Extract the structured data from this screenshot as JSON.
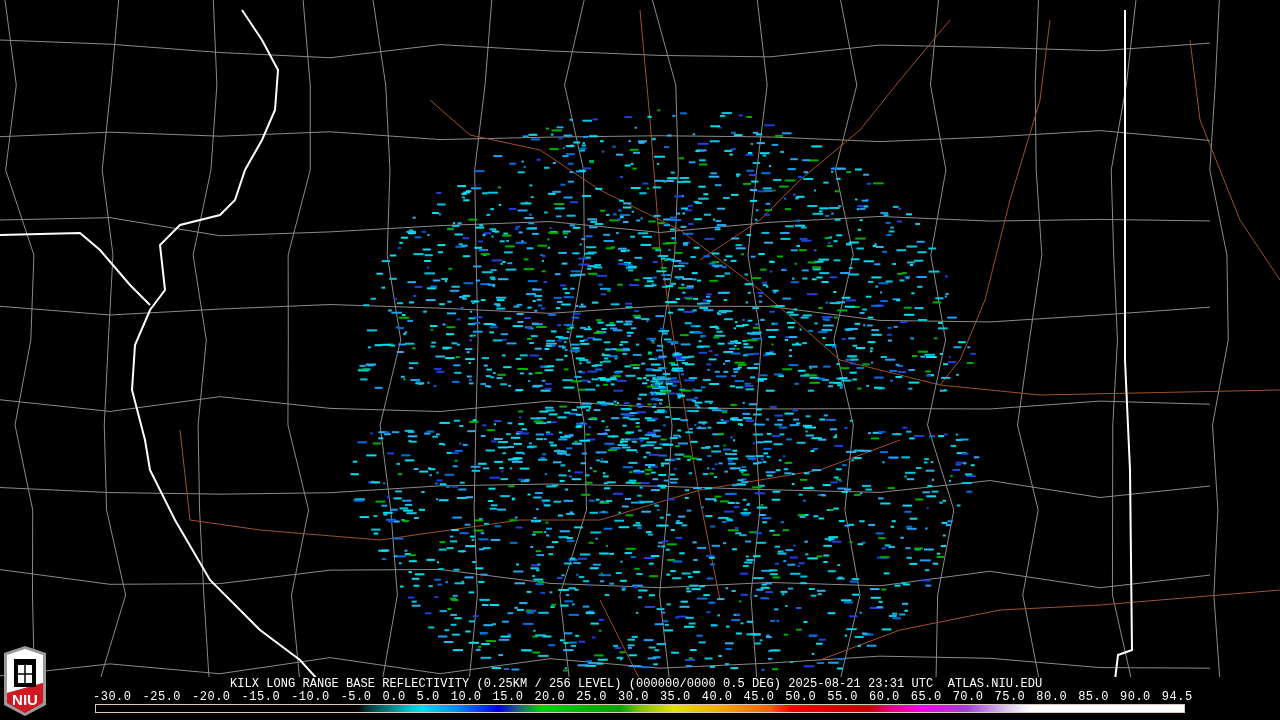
{
  "logo": {
    "text": "NIU"
  },
  "product_title": "KILX LONG RANGE BASE REFLECTIVITY (0.25KM / 256 LEVEL) (000000/0000 0.5 DEG) 2025-08-21 23:31 UTC  ATLAS.NIU.EDU",
  "scale": {
    "labels": [
      "-30.0",
      "-25.0",
      "-20.0",
      "-15.0",
      "-10.0",
      "-5.0",
      "0.0",
      "5.0",
      "10.0",
      "15.0",
      "20.0",
      "25.0",
      "30.0",
      "35.0",
      "40.0",
      "45.0",
      "50.0",
      "55.0",
      "60.0",
      "65.0",
      "70.0",
      "75.0",
      "80.0",
      "85.0",
      "90.0",
      "94.5"
    ]
  }
}
